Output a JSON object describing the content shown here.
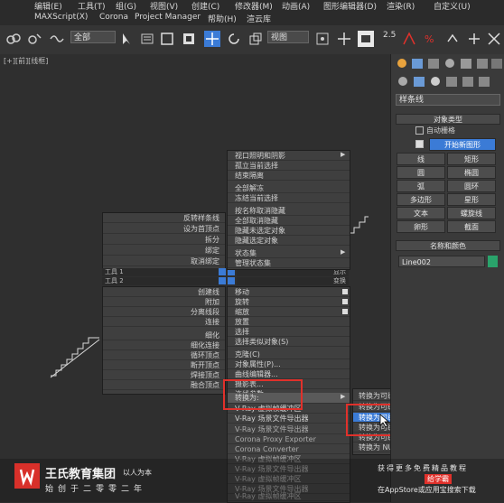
{
  "menubar_top": [
    "编辑(E)",
    "工具(T)",
    "组(G)",
    "视图(V)",
    "创建(C)",
    "修改器(M)",
    "动画(A)",
    "图形编辑器(D)",
    "渲染(R)",
    "自定义(U)"
  ],
  "menubar": [
    "MAXScript(X)",
    "Corona",
    "Project Manager",
    "帮助(H)",
    "渲云库"
  ],
  "toolbar": {
    "selection_filter": "全部",
    "coord_system": "视图",
    "snap_label": "2.5"
  },
  "viewport": {
    "label": "[+][前][线框]"
  },
  "quad_left": {
    "items": [
      "反转样条线",
      "设为首顶点",
      "拆分",
      "绑定",
      "取消绑定"
    ],
    "header1": "工具 1",
    "header2": "工具 2",
    "header1_right": "显示",
    "header2_right": "变换",
    "items2": [
      "创建线",
      "附加",
      "分离线段",
      "连接",
      "细化",
      "细化连接",
      "循环顶点",
      "断开顶点",
      "焊接顶点",
      "融合顶点"
    ]
  },
  "quad_right_top": {
    "items": [
      "视口照明和阴影",
      "孤立当前选择",
      "结束隔离",
      "全部解冻",
      "冻结当前选择",
      "按名称取消隐藏",
      "全部取消隐藏",
      "隐藏未选定对象",
      "隐藏选定对象",
      "状态集",
      "管理状态集"
    ]
  },
  "quad_right_bottom": {
    "items": [
      "移动",
      "旋转",
      "缩放",
      "放置",
      "选择",
      "选择类似对象(S)",
      "克隆(C)",
      "对象属性(P)...",
      "曲线编辑器...",
      "摄影表...",
      "连线参数...",
      "转换为:",
      "V-Ray 虚拟帧缓冲区",
      "V-Ray 场景文件导出器"
    ]
  },
  "quad_extra": [
    "V-Ray 场景文件导出器",
    "Corona Proxy Exporter",
    "Corona Converter",
    "V-Ray 虚拟帧缓冲区",
    "V-Ray 场景文件导出器",
    "V-Ray 虚拟帧缓冲区",
    "V-Ray 场景文件导出器",
    "V-Ray 虚拟帧缓冲区",
    "V-Ray 场景文件导出器"
  ],
  "submenu": {
    "items": [
      "转换为可编辑样条线",
      "转换为可编辑网格",
      "转换为可编辑多边形",
      "转换为可编辑 Poly",
      "转换为可编辑面片",
      "转换为 NURBS"
    ]
  },
  "command_panel": {
    "dropdown": "样条线",
    "object_type_title": "对象类型",
    "autogrid": "自动栅格",
    "start_new_shape": "开始新图形",
    "buttons": [
      "线",
      "矩形",
      "圆",
      "椭圆",
      "弧",
      "圆环",
      "多边形",
      "星形",
      "文本",
      "螺旋线",
      "卵形",
      "截面"
    ],
    "name_color_title": "名称和颜色",
    "object_name": "Line002",
    "object_color": "#2aa36b"
  },
  "watermark": {
    "company": "王氏教育集团",
    "slogan_small": "以人为本",
    "founded": "始创于二零零二年",
    "right_line1": "获得更多免费精品教程",
    "right_line2": "给学霸",
    "right_line3": "在AppStore或应用宝搜索下载"
  },
  "colors": {
    "highlight": "#3b7bd6",
    "annotation": "#e0312b",
    "logo_red": "#d8302a"
  }
}
